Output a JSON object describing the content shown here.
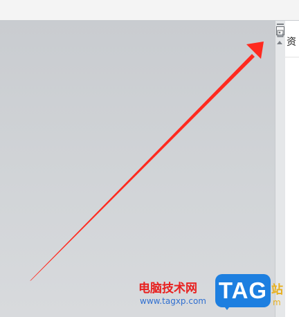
{
  "side_panel": {
    "title": "资"
  },
  "icons": {
    "panel_toggle": "image-pane-icon",
    "scroll_up": "scroll-up-arrow-icon"
  },
  "annotation": {
    "color": "#ff2a1f"
  },
  "watermark": {
    "text_cn": "电脑技术网",
    "url": "www.tagxp.com",
    "logo": "TAG",
    "text_cn_tail": "站",
    "url_tail": "m",
    "colors": {
      "cn": "#e8201f",
      "url": "#2f6fd0",
      "logo_bg": "#1d7fe0",
      "tail": "#e8b020"
    }
  }
}
